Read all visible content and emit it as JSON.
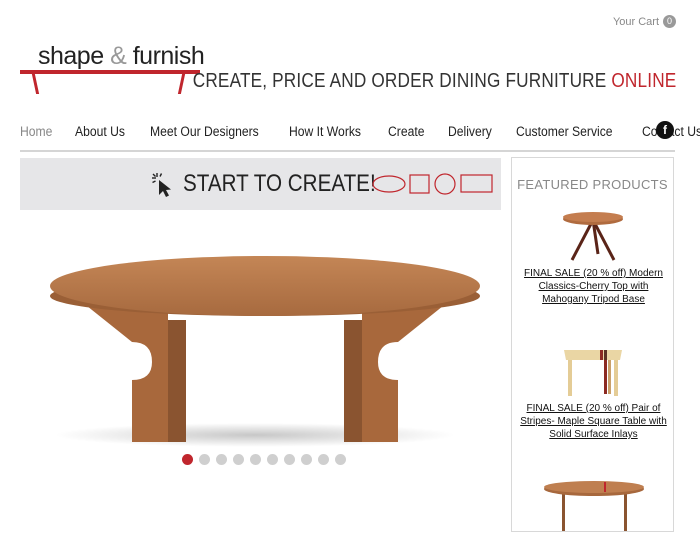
{
  "header": {
    "cart_label": "Your Cart",
    "cart_count": "0",
    "logo_word1": "shape",
    "logo_amp": "&",
    "logo_word2": "furnish",
    "tagline_main": "CREATE, PRICE AND ORDER DINING FURNITURE",
    "tagline_accent": "ONLINE"
  },
  "nav": {
    "items": [
      {
        "label": "Home"
      },
      {
        "label": "About Us"
      },
      {
        "label": "Meet Our Designers"
      },
      {
        "label": "How It Works"
      },
      {
        "label": "Create"
      },
      {
        "label": "Delivery"
      },
      {
        "label": "Customer Service"
      },
      {
        "label": "Contact Us"
      }
    ],
    "social_icon": "facebook-icon",
    "social_glyph": "f"
  },
  "banner": {
    "text": "START TO CREATE!"
  },
  "carousel": {
    "slide_count": 10,
    "active_index": 0
  },
  "sidebar": {
    "title": "FEATURED PRODUCTS",
    "products": [
      {
        "title": "FINAL SALE (20 % off) Modern Classics-Cherry Top with Mahogany Tripod Base"
      },
      {
        "title": "FINAL SALE (20 % off) Pair of Stripes- Maple Square Table with Solid Surface Inlays"
      }
    ]
  },
  "colors": {
    "accent": "#c0262d",
    "wood": "#b5764a",
    "banner_bg": "#e6e6e8"
  }
}
